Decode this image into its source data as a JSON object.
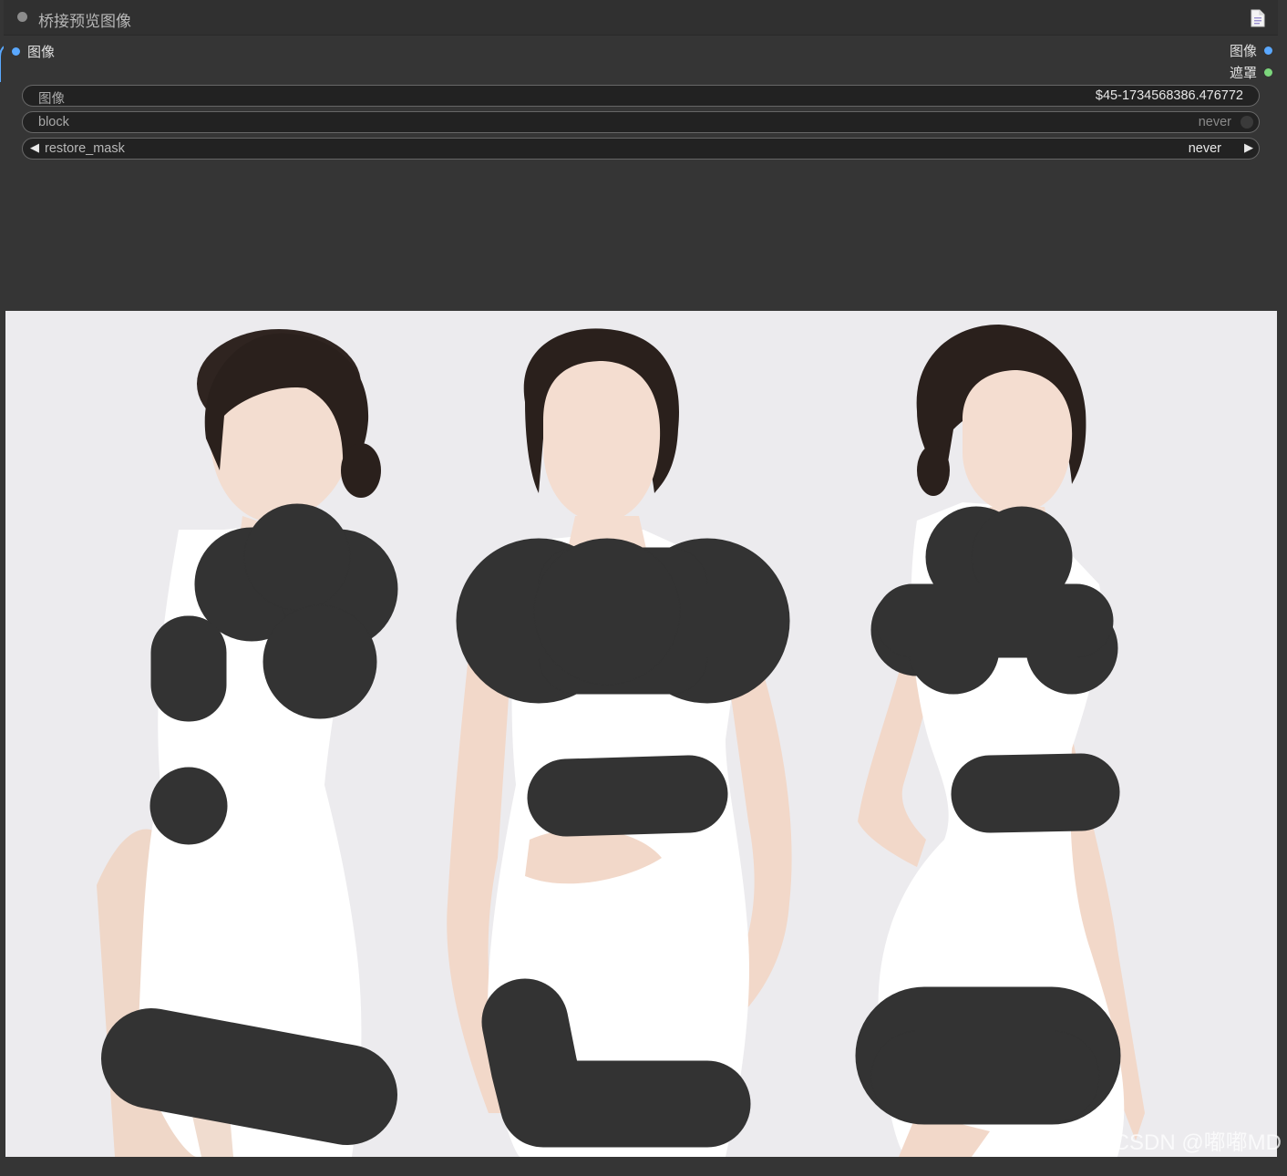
{
  "node": {
    "title": "桥接预览图像",
    "inputs": [
      {
        "label": "图像"
      }
    ],
    "outputs": [
      {
        "label": "图像"
      },
      {
        "label": "遮罩"
      }
    ],
    "widgets": {
      "image": {
        "label": "图像",
        "value": "$45-1734568386.476772"
      },
      "block": {
        "label": "block",
        "value": "never"
      },
      "restore_mask": {
        "label": "restore_mask",
        "value": "never"
      }
    }
  },
  "preview": {
    "figures": 3,
    "watermark": "CSDN @嘟嘟MD"
  },
  "colors": {
    "input_slot": "#5aa8ff",
    "mask_slot": "#7cd67c",
    "node_bg": "#353535",
    "mask_paint": "#333333"
  }
}
